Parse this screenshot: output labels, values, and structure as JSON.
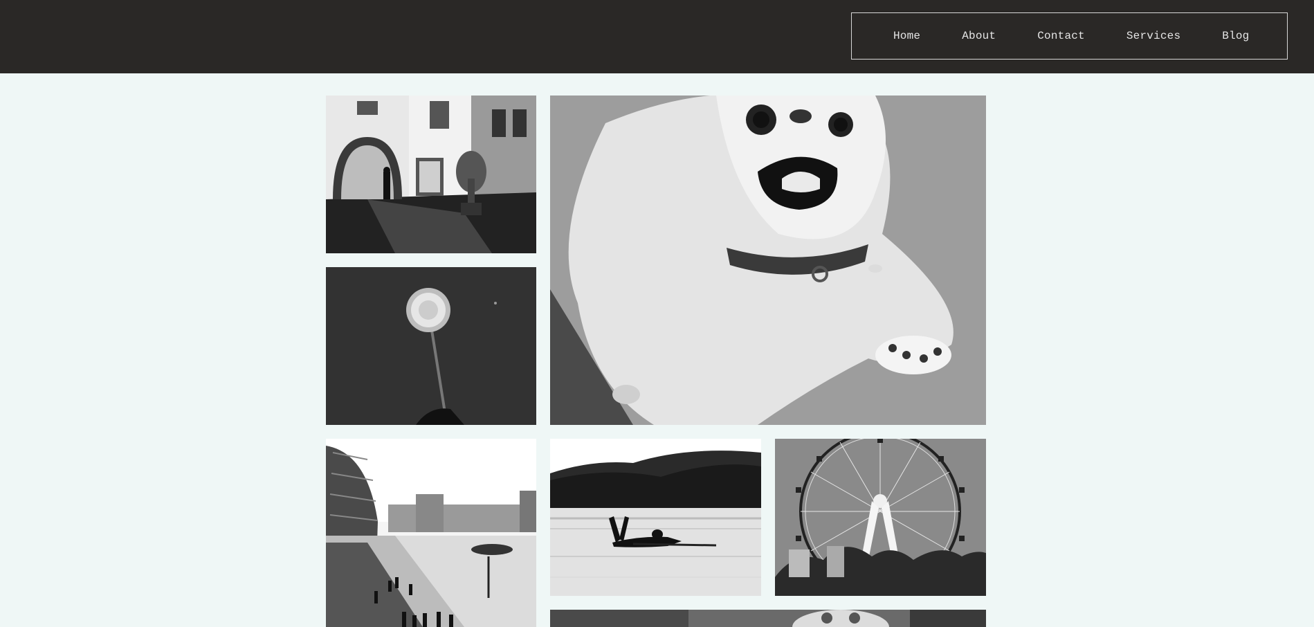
{
  "nav": {
    "items": [
      {
        "label": "Home"
      },
      {
        "label": "About"
      },
      {
        "label": "Contact"
      },
      {
        "label": "Services"
      },
      {
        "label": "Blog"
      }
    ]
  },
  "colors": {
    "header_bg": "#2a2826",
    "page_bg": "#eff7f6",
    "nav_text": "#e6e6e6",
    "nav_border": "#d9d9d9"
  },
  "gallery": {
    "photos": [
      {
        "subject": "street-scene"
      },
      {
        "subject": "small-white-dog"
      },
      {
        "subject": "dandelion"
      },
      {
        "subject": "city-riverside"
      },
      {
        "subject": "swimmer-in-water"
      },
      {
        "subject": "ferris-wheel"
      },
      {
        "subject": "partial-photo"
      }
    ]
  }
}
